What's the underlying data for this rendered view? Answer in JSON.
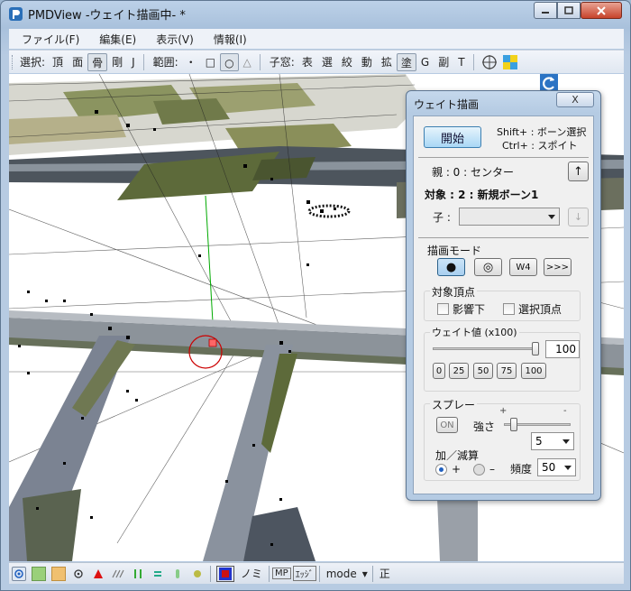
{
  "window": {
    "title": "PMDView -ウェイト描画中- *",
    "controls": {
      "minimize": "0",
      "maximize": "1",
      "close": "r"
    }
  },
  "menu": {
    "items": [
      {
        "name": "file",
        "label": "ファイル(F)"
      },
      {
        "name": "edit",
        "label": "編集(E)"
      },
      {
        "name": "view",
        "label": "表示(V)"
      },
      {
        "name": "info",
        "label": "情報(I)"
      }
    ]
  },
  "toolbar": {
    "select_label": "選択:",
    "select_items": [
      "頂",
      "面",
      "骨",
      "剛",
      "J"
    ],
    "select_pressed": "骨",
    "range_label": "範囲:",
    "range_items": [
      "・",
      "□",
      "○",
      "△"
    ],
    "window_label": "子窓:",
    "window_items": [
      "表",
      "選",
      "絞",
      "動",
      "拡",
      "塗",
      "G",
      "副",
      "T"
    ],
    "window_pressed": "塗"
  },
  "statusbar": {
    "labels": {
      "mi": "ノミ",
      "mp": "MP",
      "edge": "ｴｯｼﾞ",
      "mode": "mode",
      "mode_arrow": "▾",
      "sei": "正"
    }
  },
  "dialog": {
    "title": "ウェイト描画",
    "close_label": "X",
    "start_button": "開始",
    "shortcut_shift": "Shift+ : ボーン選択",
    "shortcut_ctrl": "Ctrl+ : スポイト",
    "parent_text": "親 : 0 : センター",
    "parent_button": "↑",
    "target_text": "対象 : 2 : 新規ボーン1",
    "child_label": "子 :",
    "child_value": "",
    "child_button": "↓",
    "paint_mode_label": "描画モード",
    "paint_mode_buttons": [
      "●",
      "◎",
      "W4",
      ">>>"
    ],
    "paint_mode_selected": "●",
    "target_vertex_label": "対象頂点",
    "affect_label": "影響下",
    "affect_checked": false,
    "selected_vertex_label": "選択頂点",
    "selected_vertex_checked": false,
    "weight_label": "ウェイト値 (x100)",
    "weight_value": "100",
    "weight_slider": 1.0,
    "weight_presets": [
      "0",
      "25",
      "50",
      "75",
      "100"
    ],
    "spray_label": "スプレー",
    "on_button": "ON",
    "strength_label": "強さ",
    "strength_plus": "+",
    "strength_minus": "-",
    "strength_slider": 0.1,
    "strength_value": "5",
    "addsub_label": "加／減算",
    "add_label": "+",
    "sub_label": "–",
    "add_selected": true,
    "frequency_label": "頻度",
    "frequency_value": "50"
  },
  "colors": {
    "title_bg": "#b9cfe7",
    "dialog_start": "#a9d7f5",
    "bone_red": "#cc0000",
    "axis_green": "#00aa00"
  }
}
